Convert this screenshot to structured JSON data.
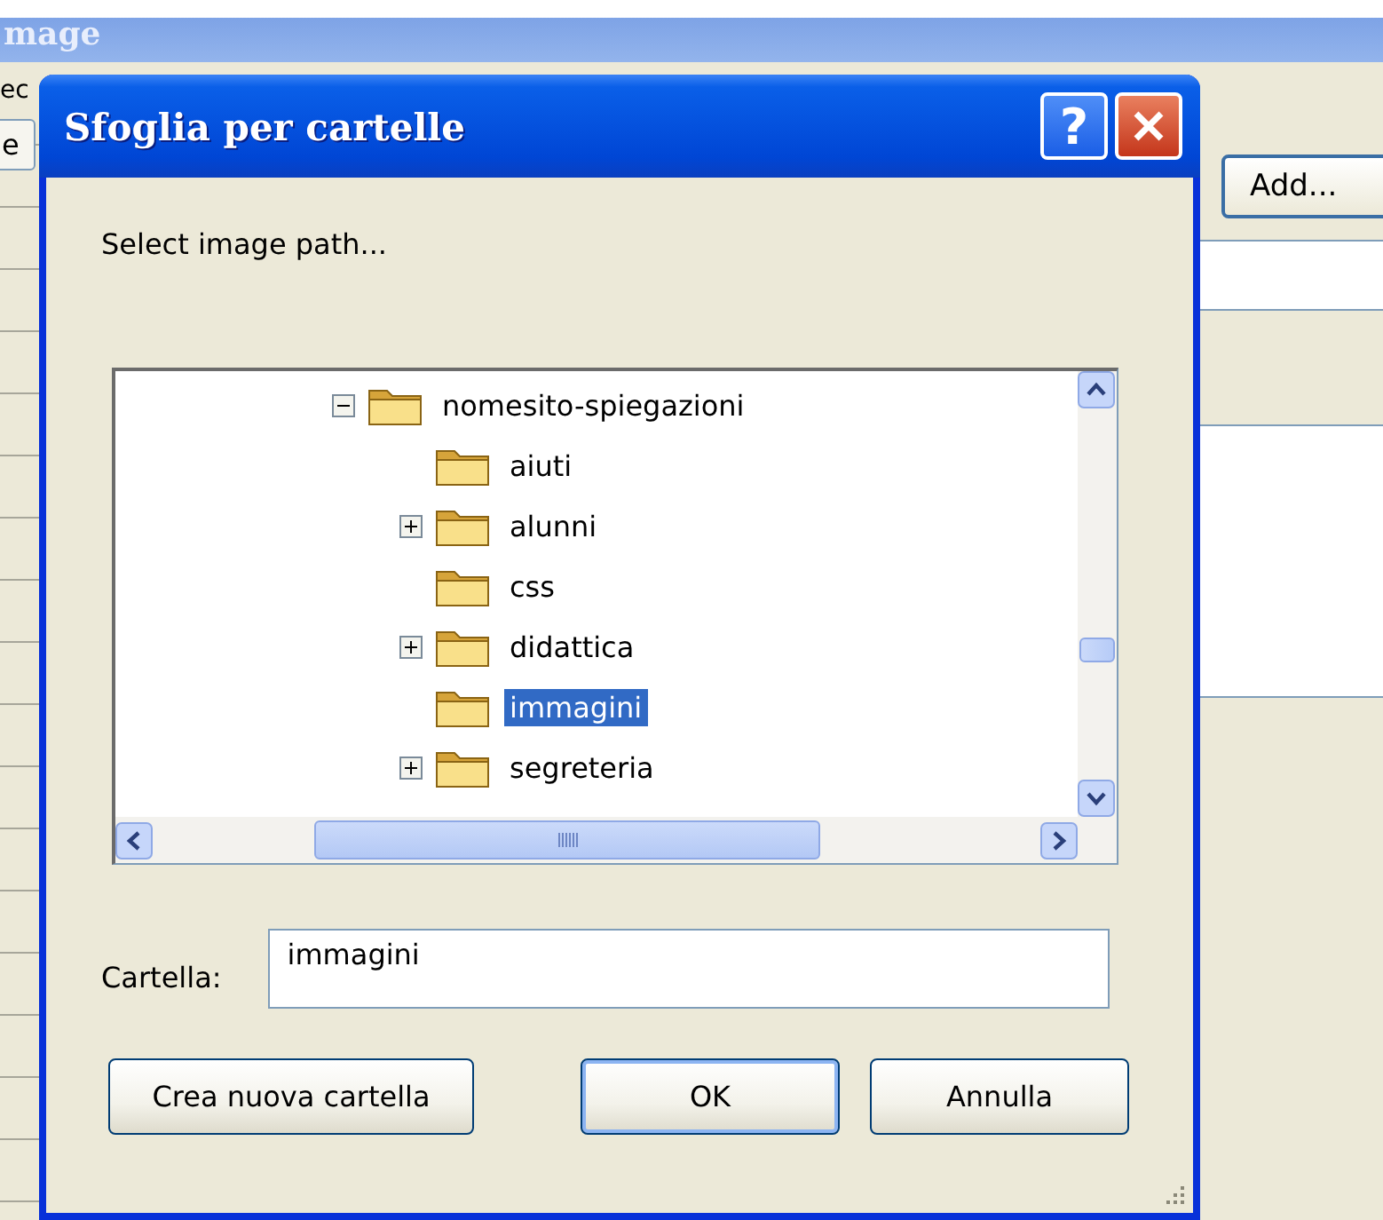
{
  "background_window": {
    "title": "mage",
    "left_fragments": [
      "ec",
      "e"
    ],
    "add_button": "Add..."
  },
  "dialog": {
    "title": "Sfoglia per cartelle",
    "help_button": "?",
    "prompt": "Select image path...",
    "tree": [
      {
        "label": "nomesito-spiegazioni",
        "expanded": true,
        "selected": false,
        "children": [
          {
            "label": "aiuti",
            "selected": false
          },
          {
            "label": "alunni",
            "expanded": false,
            "selected": false
          },
          {
            "label": "css",
            "selected": false
          },
          {
            "label": "didattica",
            "expanded": false,
            "selected": false
          },
          {
            "label": "immagini",
            "selected": true
          },
          {
            "label": "segreteria",
            "expanded": false,
            "selected": false
          }
        ]
      }
    ],
    "folder_label": "Cartella:",
    "folder_value": "immagini",
    "buttons": [
      {
        "label": "Crea nuova cartella",
        "default": false
      },
      {
        "label": "OK",
        "default": true
      },
      {
        "label": "Annulla",
        "default": false
      }
    ]
  }
}
